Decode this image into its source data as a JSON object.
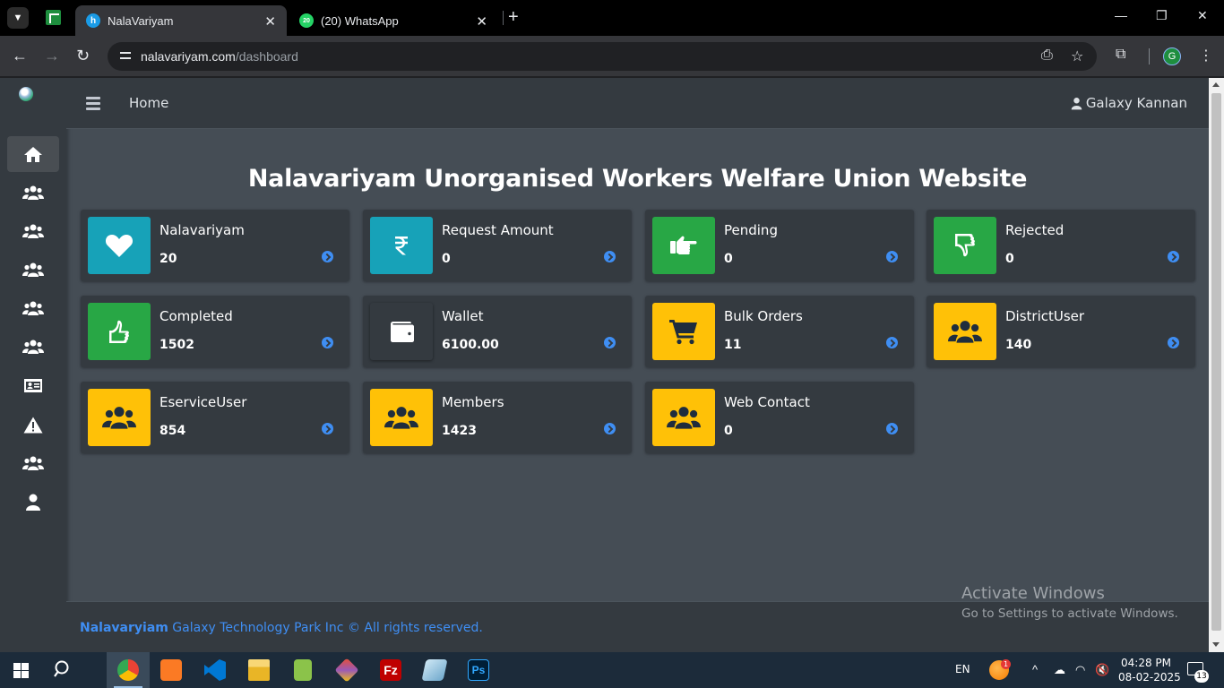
{
  "browser": {
    "tabs": [
      {
        "title": "NalaVariyam",
        "favicon": "h",
        "active": true
      },
      {
        "title": "(20) WhatsApp",
        "favicon": "20",
        "active": false
      }
    ],
    "url_domain": "nalavariyam.com",
    "url_path": "/dashboard",
    "profile_initial": "G"
  },
  "topnav": {
    "home_label": "Home",
    "user_name": "Galaxy Kannan"
  },
  "page_title": "Nalavariyam Unorganised Workers Welfare Union Website",
  "cards": [
    {
      "label": "Nalavariyam",
      "value": "20",
      "icon": "heart-icon",
      "color": "#17a2b8"
    },
    {
      "label": "Request Amount",
      "value": "0",
      "icon": "rupee-icon",
      "color": "#17a2b8"
    },
    {
      "label": "Pending",
      "value": "0",
      "icon": "hand-point-right-icon",
      "color": "#28a745"
    },
    {
      "label": "Rejected",
      "value": "0",
      "icon": "thumbs-down-icon",
      "color": "#28a745"
    },
    {
      "label": "Completed",
      "value": "1502",
      "icon": "thumbs-up-icon",
      "color": "#28a745"
    },
    {
      "label": "Wallet",
      "value": "6100.00",
      "icon": "wallet-icon",
      "color": "#343a40"
    },
    {
      "label": "Bulk Orders",
      "value": "11",
      "icon": "cart-icon",
      "color": "#ffc107"
    },
    {
      "label": "DistrictUser",
      "value": "140",
      "icon": "users-icon",
      "color": "#ffc107"
    },
    {
      "label": "EserviceUser",
      "value": "854",
      "icon": "users-icon",
      "color": "#ffc107"
    },
    {
      "label": "Members",
      "value": "1423",
      "icon": "users-icon",
      "color": "#ffc107"
    },
    {
      "label": "Web Contact",
      "value": "0",
      "icon": "users-icon",
      "color": "#ffc107"
    }
  ],
  "sidebar_icons": [
    "home-icon",
    "users-icon",
    "users-icon",
    "users-icon",
    "users-icon",
    "users-icon",
    "id-card-icon",
    "warning-icon",
    "users-icon",
    "user-icon"
  ],
  "footer": {
    "brand": "Nalavaryiam",
    "text": " Galaxy Technology Park Inc © All rights reserved."
  },
  "watermark": {
    "line1": "Activate Windows",
    "line2": "Go to Settings to activate Windows."
  },
  "taskbar": {
    "language": "EN",
    "time": "04:28 PM",
    "date": "08-02-2025",
    "notification_count": "13",
    "weather_badge": "1"
  }
}
